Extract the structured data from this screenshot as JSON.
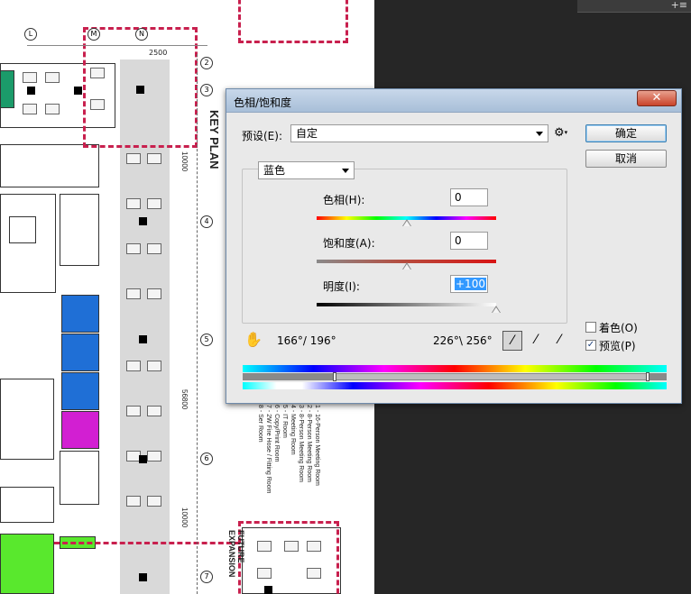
{
  "window": {
    "title": "色相/饱和度",
    "close_glyph": "✕"
  },
  "preset": {
    "label": "预设(E):",
    "value": "自定"
  },
  "settings_icon": "gear-icon",
  "buttons": {
    "ok": "确定",
    "cancel": "取消"
  },
  "channel": {
    "value": "蓝色"
  },
  "hue": {
    "label": "色相(H):",
    "value": "0",
    "fraction": 0.5
  },
  "saturation": {
    "label": "饱和度(A):",
    "value": "0",
    "fraction": 0.5
  },
  "lightness": {
    "label": "明度(I):",
    "value": "+100",
    "fraction": 1.0
  },
  "range": {
    "left": "166°/ 196°",
    "right": "226°\\ 256°"
  },
  "options": {
    "colorize": {
      "label": "着色(O)",
      "checked": false
    },
    "preview": {
      "label": "预览(P)",
      "checked": true
    }
  },
  "colors": {
    "dashed_boundary": "#c8204e",
    "office_blue": "#1f6fd6",
    "office_magenta": "#d21fd2",
    "office_green": "#59e82d",
    "office_teal": "#1b9b6a"
  },
  "drawing": {
    "key_plan": "KEY PLAN",
    "future_expansion": "FUTURE EXPANSION",
    "grid_numbers": [
      "2",
      "3",
      "4",
      "5",
      "6",
      "7"
    ],
    "grid_letters": [
      "L",
      "M",
      "N"
    ],
    "dimension_upper": "10000",
    "dimension_total": "56800",
    "dimension_lower": "10000",
    "dimension_top": "2500",
    "legend_items": [
      "1 - 16-Person Meeting Room",
      "2 - 8-Person Meeting Room",
      "3 - 8-Person Meeting Room",
      "4 - Meeting Room",
      "5 - IT Room",
      "6 - Copy/Print Room",
      "7 - 2W Fire Hose / Fitting Room",
      "8 - Ser Room"
    ]
  }
}
